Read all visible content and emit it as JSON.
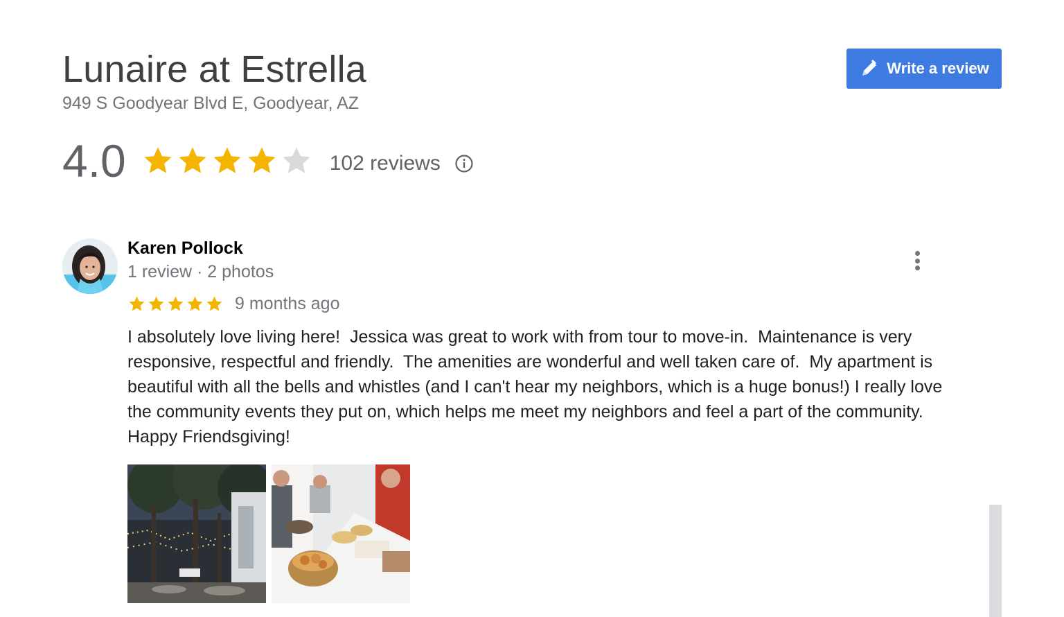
{
  "place": {
    "name": "Lunaire at Estrella",
    "address": "949 S Goodyear Blvd E, Goodyear, AZ"
  },
  "actions": {
    "write_review_label": "Write a review",
    "write_review_icon": "pencil-icon"
  },
  "summary": {
    "rating": "4.0",
    "stars_filled": 4,
    "stars_total": 5,
    "review_count_label": "102 reviews",
    "info_icon": "info-icon"
  },
  "colors": {
    "accent": "#3d7be0",
    "star_filled": "#f4b400",
    "star_empty": "#d9d9d9"
  },
  "reviews": [
    {
      "author": "Karen Pollock",
      "author_meta": "1 review · 2 photos",
      "rating": 5,
      "date": "9 months ago",
      "text": "I absolutely love living here!  Jessica was great to work with from tour to move-in.  Maintenance is very responsive, respectful and friendly.  The amenities are wonderful and well taken care of.  My apartment is beautiful with all the bells and whistles (and I can't hear my neighbors, which is a huge bonus!) I really love the community events they put on, which helps me meet my neighbors and feel a part of the community.  Happy Friendsgiving!",
      "photos": [
        "courtyard-string-lights-photo",
        "friendsgiving-buffet-photo"
      ]
    }
  ]
}
